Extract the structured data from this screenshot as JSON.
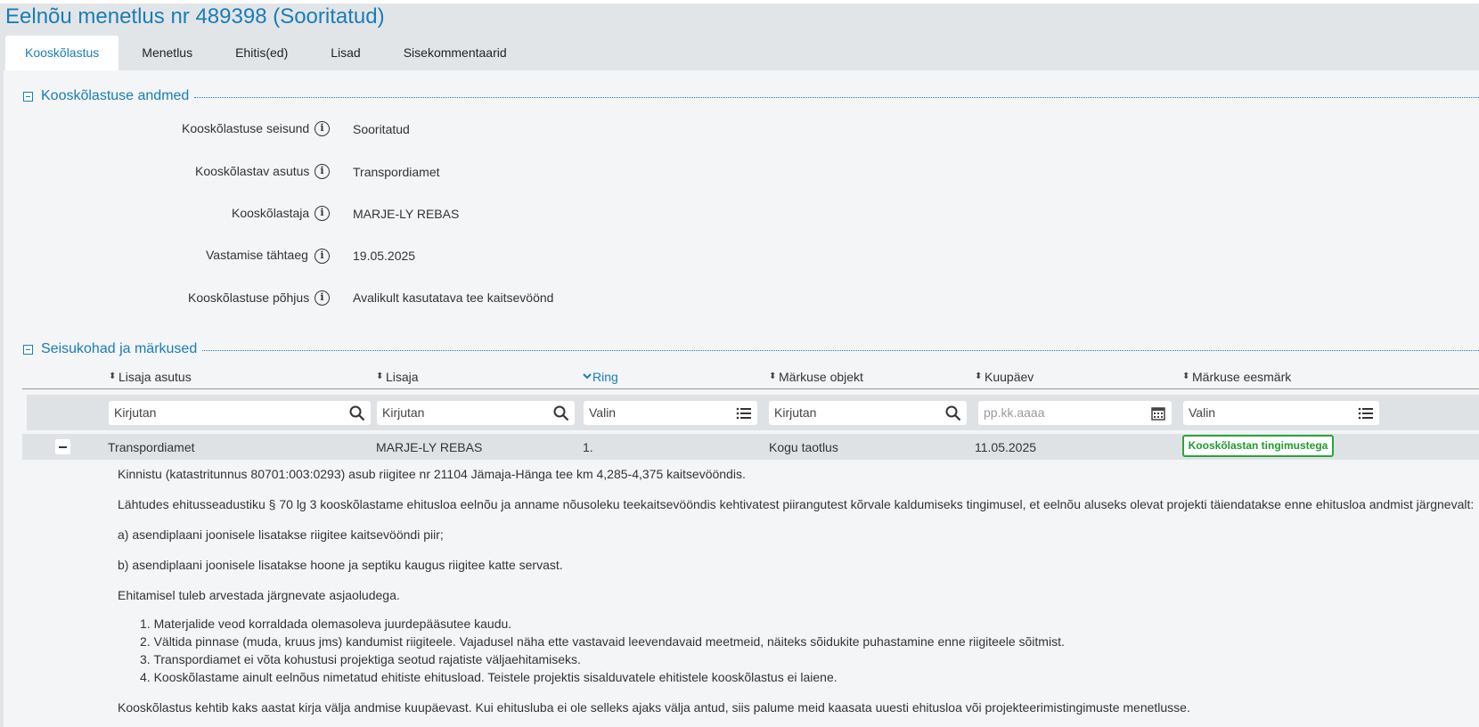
{
  "page_title": "Eelnõu menetlus nr 489398 (Sooritatud)",
  "tabs": [
    {
      "label": "Kooskõlastus",
      "active": true
    },
    {
      "label": "Menetlus"
    },
    {
      "label": "Ehitis(ed)"
    },
    {
      "label": "Lisad"
    },
    {
      "label": "Sisekommentaarid"
    }
  ],
  "section1": {
    "title": "Kooskõlastuse andmed",
    "fields": [
      {
        "label": "Kooskõlastuse seisund",
        "value": "Sooritatud"
      },
      {
        "label": "Kooskõlastav asutus",
        "value": "Transpordiamet"
      },
      {
        "label": "Kooskõlastaja",
        "value": "MARJE-LY REBAS"
      },
      {
        "label": "Vastamise tähtaeg",
        "value": "19.05.2025"
      },
      {
        "label": "Kooskõlastuse põhjus",
        "value": "Avalikult kasutatava tee kaitsevöönd"
      }
    ]
  },
  "section2": {
    "title": "Seisukohad ja märkused",
    "columns": [
      "Lisaja asutus",
      "Lisaja",
      "Ring",
      "Märkuse objekt",
      "Kuupäev",
      "Märkuse eesmärk"
    ],
    "sorted_column": "Ring",
    "filters": [
      {
        "placeholder": "Kirjutan",
        "icon": "search-icon"
      },
      {
        "placeholder": "Kirjutan",
        "icon": "search-icon"
      },
      {
        "placeholder": "Valin",
        "icon": "list-icon"
      },
      {
        "placeholder": "Kirjutan",
        "icon": "search-icon"
      },
      {
        "placeholder": "pp.kk.aaaa",
        "icon": "calendar-icon"
      },
      {
        "placeholder": "Valin",
        "icon": "list-icon"
      }
    ],
    "row": {
      "asutus": "Transpordiamet",
      "lisaja": "MARJE-LY REBAS",
      "ring": "1.",
      "objekt": "Kogu taotlus",
      "kuupaev": "11.05.2025",
      "eesmark": "Kooskõlastan tingimustega"
    },
    "comment": {
      "p1": "Kinnistu (katastritunnus 80701:003:0293) asub riigitee nr 21104 Jämaja-Hänga tee km 4,285-4,375 kaitsevööndis.",
      "p2": "Lähtudes ehitusseadustiku § 70 lg 3 kooskõlastame ehitusloa eelnõu ja anname nõusoleku teekaitsevööndis kehtivatest piirangutest kõrvale kaldumiseks tingimusel, et eelnõu aluseks olevat projekti täiendatakse enne ehitusloa andmist järgnevalt:",
      "p3": "a) asendiplaani joonisele lisatakse riigitee kaitsevööndi piir;",
      "p4": "b) asendiplaani joonisele lisatakse hoone ja septiku kaugus riigitee katte servast.",
      "p5": "Ehitamisel tuleb arvestada järgnevate asjaoludega.",
      "list": [
        "1. Materjalide veod korraldada olemasoleva juurdepääsutee kaudu.",
        "2. Vältida pinnase (muda, kruus jms) kandumist riigiteele. Vajadusel näha ette vastavaid leevendavaid meetmeid, näiteks sõidukite puhastamine enne riigiteele sõitmist.",
        "3. Transpordiamet ei võta kohustusi projektiga seotud rajatiste väljaehitamiseks.",
        "4. Kooskõlastame ainult eelnõus nimetatud ehitiste ehitusload. Teistele projektis sisalduvatele ehitistele kooskõlastus ei laiene."
      ],
      "p6": "Kooskõlastus kehtib kaks aastat kirja välja andmise kuupäevast. Kui ehitusluba ei ole selleks ajaks välja antud, siis palume meid kaasata uuesti ehitusloa või projekteerimistingimuste menetlusse."
    }
  },
  "colors": {
    "accent": "#1a7db6",
    "badge_green": "#2aa43c"
  }
}
